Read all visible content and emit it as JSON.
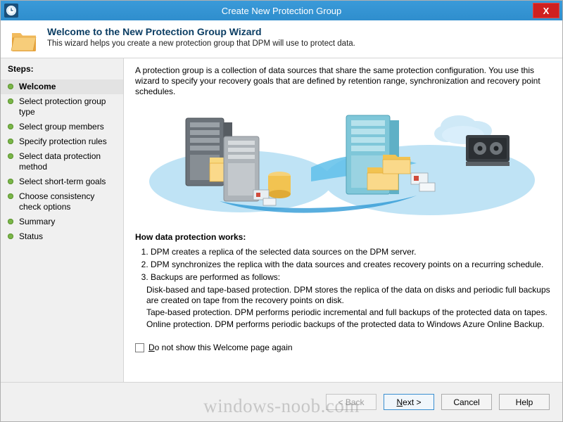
{
  "window": {
    "title": "Create New Protection Group",
    "close_label": "X",
    "icon": "dpm-clock-icon"
  },
  "banner": {
    "title": "Welcome to the New Protection Group Wizard",
    "subtitle": "This wizard helps you create a new protection group that DPM will use to protect data.",
    "icon": "folder-icon"
  },
  "sidebar": {
    "heading": "Steps:",
    "items": [
      {
        "label": "Welcome",
        "active": true
      },
      {
        "label": "Select protection group type",
        "active": false
      },
      {
        "label": "Select group members",
        "active": false
      },
      {
        "label": "Specify protection rules",
        "active": false
      },
      {
        "label": "Select data protection method",
        "active": false
      },
      {
        "label": "Select short-term goals",
        "active": false
      },
      {
        "label": "Choose consistency check options",
        "active": false
      },
      {
        "label": "Summary",
        "active": false
      },
      {
        "label": "Status",
        "active": false
      }
    ]
  },
  "content": {
    "intro": "A protection group is a collection of data sources that share the same protection configuration. You use this wizard to specify your recovery goals that are defined by retention range, synchronization and recovery point schedules.",
    "how_title": "How data protection works:",
    "steps": [
      "DPM creates a replica of the selected data sources on the DPM server.",
      "DPM synchronizes the replica with the data sources and creates recovery points on a recurring schedule.",
      "Backups are performed as follows:"
    ],
    "sub_paragraphs": [
      "Disk-based and tape-based protection. DPM stores the replica of the data on disks and periodic full backups are created on tape from the recovery points on disk.",
      "Tape-based protection. DPM performs periodic incremental and full backups of the protected data on tapes.",
      "Online protection. DPM performs periodic backups of the protected data to Windows Azure Online Backup."
    ],
    "checkbox_label": "Do not show this Welcome page again",
    "checkbox_checked": false
  },
  "footer": {
    "back": "< Back",
    "next": "Next >",
    "cancel": "Cancel",
    "help": "Help"
  },
  "watermark": "windows-noob.com",
  "colors": {
    "titlebar": "#2f8ecd",
    "close": "#d02020",
    "bullet": "#7ab648",
    "banner_title": "#0b3d63"
  }
}
